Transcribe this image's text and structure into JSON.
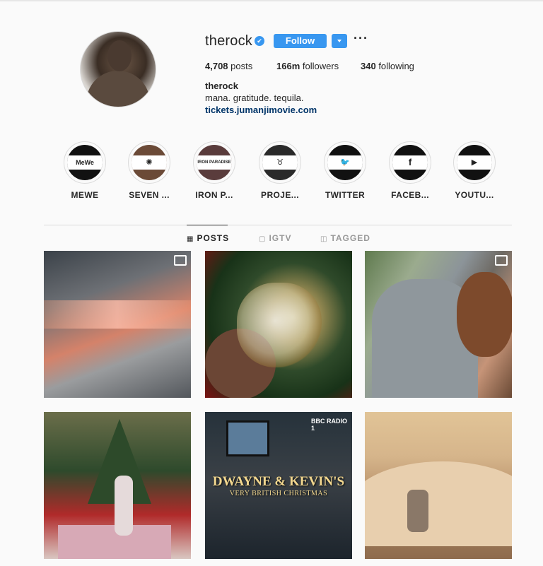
{
  "profile": {
    "username": "therock",
    "verified_mark": "✔",
    "follow_label": "Follow",
    "more_label": "···",
    "stats": {
      "posts_count": "4,708",
      "posts_label": " posts",
      "followers_count": "166m",
      "followers_label": " followers",
      "following_count": "340",
      "following_label": " following"
    },
    "full_name": "therock",
    "bio": "mana. gratitude. tequila.",
    "link": "tickets.jumanjimovie.com",
    "accent_color": "#3897f0"
  },
  "highlights": [
    {
      "label": "MEWE",
      "icon": "mewe-logo",
      "band_text": "MeWe"
    },
    {
      "label": "SEVEN ...",
      "icon": "seven-bucks-logo",
      "band_text": "✺"
    },
    {
      "label": "IRON P...",
      "icon": "iron-paradise-logo",
      "band_text": "IRON PARADISE"
    },
    {
      "label": "PROJE...",
      "icon": "project-rock-bull-icon",
      "band_text": "♉"
    },
    {
      "label": "TWITTER",
      "icon": "twitter-icon",
      "band_text": "🐦"
    },
    {
      "label": "FACEB...",
      "icon": "facebook-icon",
      "band_text": "f"
    },
    {
      "label": "YOUTU...",
      "icon": "youtube-icon",
      "band_text": "▶"
    }
  ],
  "tabs": [
    {
      "label": "POSTS",
      "icon": "grid-icon",
      "glyph": "▦",
      "active": true
    },
    {
      "label": "IGTV",
      "icon": "igtv-icon",
      "glyph": "▢",
      "active": false
    },
    {
      "label": "TAGGED",
      "icon": "tag-icon",
      "glyph": "◫",
      "active": false
    }
  ],
  "posts": [
    {
      "description": "bottling line",
      "badge": "igtv"
    },
    {
      "description": "tequila glass",
      "badge": ""
    },
    {
      "description": "embrace",
      "badge": "igtv"
    },
    {
      "description": "christmas tree",
      "badge": ""
    },
    {
      "description": "bbc radio 1",
      "overlay_title": "DWAYNE & KEVIN'S",
      "overlay_subtitle": "VERY BRITISH CHRISTMAS",
      "overlay_brand": "BBC RADIO 1",
      "badge": ""
    },
    {
      "description": "desert dunes",
      "badge": ""
    }
  ]
}
